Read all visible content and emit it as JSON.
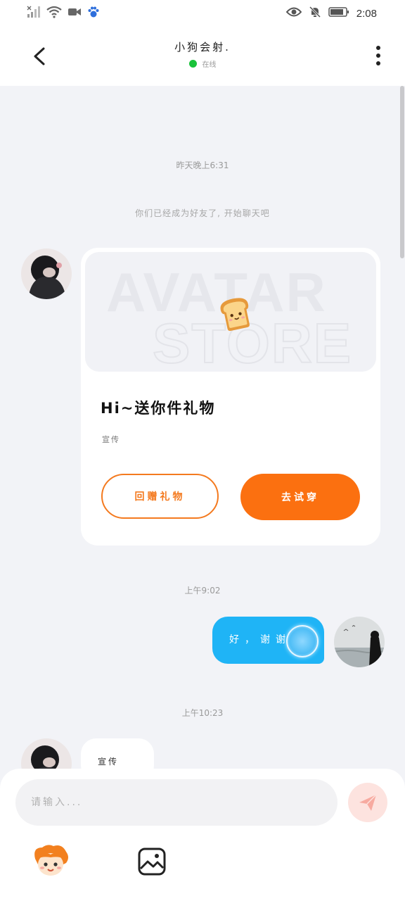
{
  "status_bar": {
    "time": "2:08"
  },
  "header": {
    "title": "小狗会射.",
    "status": "在线"
  },
  "messages": {
    "timestamp_1": "昨天晚上6:31",
    "system_notice": "你们已经成为好友了, 开始聊天吧",
    "card": {
      "watermark_line1": "AVATAR",
      "watermark_line2": "STORE",
      "title": "Hi~送你件礼物",
      "subtitle": "宣传",
      "button_return_gift": "回赠礼物",
      "button_try": "去试穿"
    },
    "timestamp_2": "上午9:02",
    "outgoing_text": "好，谢谢",
    "timestamp_3": "上午10:23",
    "incoming_text": "宣传"
  },
  "composer": {
    "placeholder": "请输入..."
  },
  "colors": {
    "accent_orange": "#fb7010",
    "bubble_blue": "#1fb4f6",
    "online_green": "#19c23a"
  }
}
